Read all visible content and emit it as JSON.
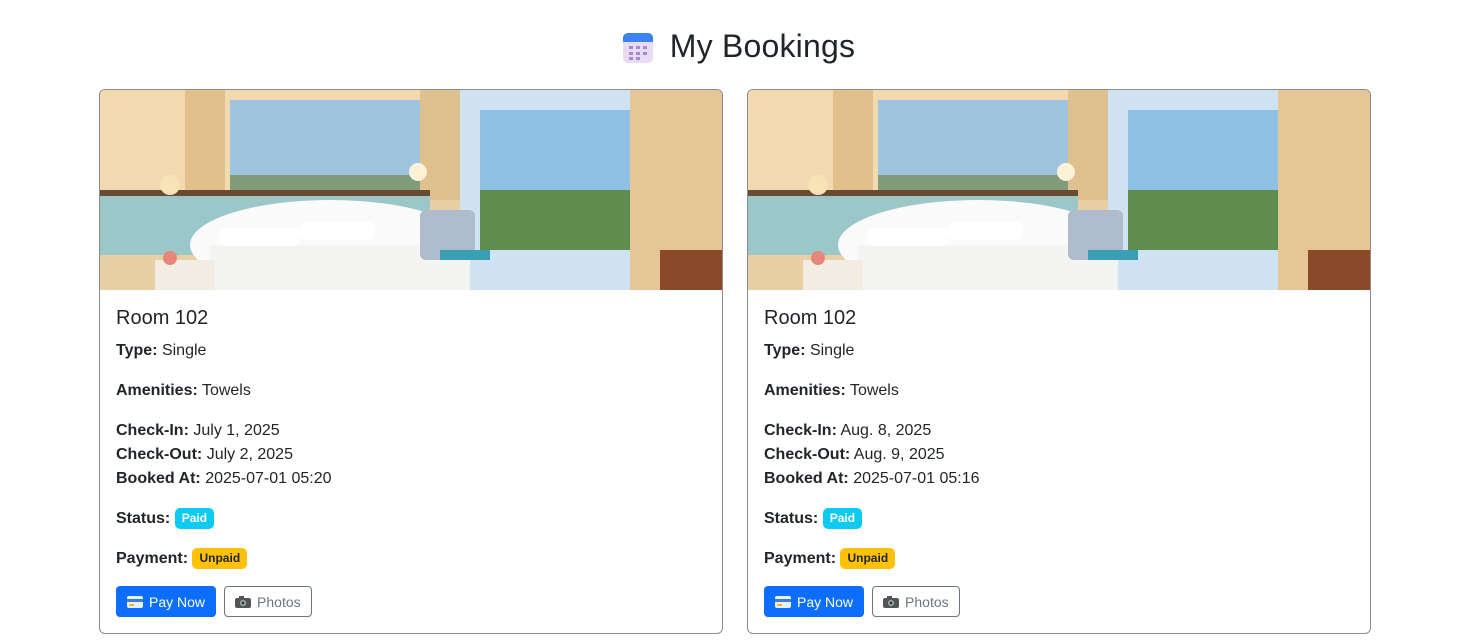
{
  "header": {
    "title": "My Bookings",
    "icon": "calendar-icon"
  },
  "labels": {
    "type": "Type:",
    "amenities": "Amenities:",
    "check_in": "Check-In:",
    "check_out": "Check-Out:",
    "booked_at": "Booked At:",
    "status": "Status:",
    "payment": "Payment:",
    "pay_now": "Pay Now",
    "photos": "Photos"
  },
  "bookings": [
    {
      "room": "Room 102",
      "type": "Single",
      "amenities": "Towels",
      "check_in": "July 1, 2025",
      "check_out": "July 2, 2025",
      "booked_at": "2025-07-01 05:20",
      "status": "Paid",
      "payment": "Unpaid"
    },
    {
      "room": "Room 102",
      "type": "Single",
      "amenities": "Towels",
      "check_in": "Aug. 8, 2025",
      "check_out": "Aug. 9, 2025",
      "booked_at": "2025-07-01 05:16",
      "status": "Paid",
      "payment": "Unpaid"
    }
  ],
  "colors": {
    "primary": "#0d6efd",
    "info_badge": "#0dcaf0",
    "warning_badge": "#ffc107",
    "outline_secondary": "#6c757d"
  }
}
